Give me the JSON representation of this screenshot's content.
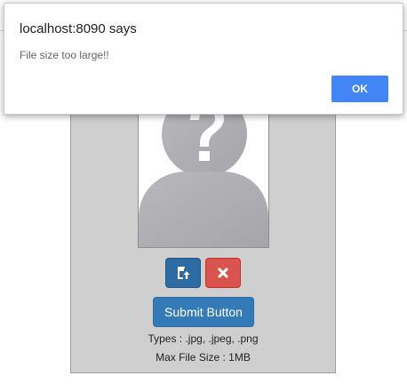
{
  "dialog": {
    "title": "localhost:8090 says",
    "message": "File size too large!!",
    "ok_label": "OK"
  },
  "uploader": {
    "submit_label": "Submit Button",
    "types_text": "Types : .jpg, .jpeg, .png",
    "max_size_text": "Max File Size : 1MB",
    "upload_icon": "upload-file-icon",
    "remove_icon": "close-icon",
    "placeholder_icon": "unknown-person-icon"
  },
  "colors": {
    "card_bg": "#cfcfcf",
    "upload_button": "#2d6ca2",
    "remove_button": "#d9534f",
    "submit_button": "#337ab7",
    "ok_button": "#4285f4"
  }
}
